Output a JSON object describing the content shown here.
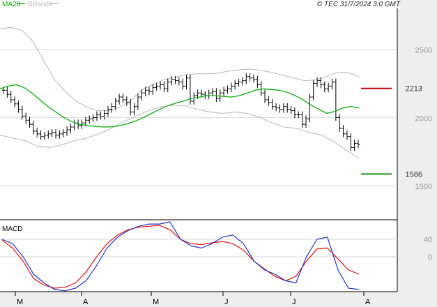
{
  "header": {
    "ma_label": "MA20",
    "bb_label": "BBands",
    "copyright": "© TEC 31/7/2024 3:0 GMT"
  },
  "colors": {
    "ma": "#11aa11",
    "bands": "#b8b8b8",
    "bars": "#000000",
    "resistance": "#cc0000",
    "support": "#119911",
    "macd": "#2233cc",
    "signal": "#dd1111",
    "grid": "#d8d8d8",
    "right_panel": "#eeeeee",
    "axis_text": "#999999"
  },
  "chart_data": [
    {
      "type": "line",
      "name": "price",
      "x_tick_labels": [
        "M",
        "A",
        "M",
        "J",
        "J",
        "A"
      ],
      "y_tick_labels": [
        "2500",
        "2000",
        "1500"
      ],
      "ylim": [
        1250,
        2800
      ],
      "grid": true,
      "levels": [
        {
          "label": "2213",
          "value": 2213,
          "color": "#cc0000"
        },
        {
          "label": "1586",
          "value": 1586,
          "color": "#119911"
        }
      ],
      "ohlc_close": [
        2200,
        2170,
        2130,
        2100,
        2060,
        2010,
        1980,
        1950,
        1900,
        1880,
        1860,
        1870,
        1880,
        1890,
        1870,
        1880,
        1890,
        1910,
        1930,
        1960,
        1940,
        1960,
        1980,
        1990,
        2000,
        2020,
        2010,
        2030,
        2060,
        2080,
        2120,
        2150,
        2130,
        2110,
        2040,
        2080,
        2150,
        2180,
        2200,
        2190,
        2220,
        2230,
        2240,
        2210,
        2260,
        2280,
        2270,
        2260,
        2230,
        2290,
        2120,
        2160,
        2180,
        2170,
        2160,
        2180,
        2190,
        2140,
        2180,
        2200,
        2210,
        2230,
        2250,
        2260,
        2270,
        2300,
        2290,
        2280,
        2240,
        2180,
        2130,
        2110,
        2080,
        2070,
        2060,
        2080,
        2060,
        2050,
        2020,
        2020,
        1950,
        1990,
        2150,
        2250,
        2270,
        2240,
        2210,
        2230,
        2260,
        2000,
        1920,
        1880,
        1860,
        1780,
        1810,
        1800
      ],
      "series": [
        {
          "name": "MA20",
          "values": [
            2210,
            2230,
            2240,
            2220,
            2180,
            2130,
            2080,
            2040,
            2000,
            1970,
            1950,
            1940,
            1935,
            1930,
            1932,
            1940,
            1955,
            1975,
            2000,
            2030,
            2060,
            2085,
            2105,
            2120,
            2140,
            2150,
            2160,
            2160,
            2155,
            2150,
            2160,
            2180,
            2200,
            2210,
            2205,
            2200,
            2185,
            2160,
            2130,
            2090,
            2060,
            2030,
            2045,
            2070,
            2080,
            2070
          ]
        },
        {
          "name": "BBands upper",
          "values": [
            2650,
            2660,
            2640,
            2560,
            2420,
            2280,
            2190,
            2120,
            2075,
            2050,
            2050,
            2075,
            2125,
            2200,
            2240,
            2275,
            2295,
            2310,
            2320,
            2320,
            2325,
            2340,
            2350,
            2355,
            2345,
            2330,
            2310,
            2290,
            2270,
            2275,
            2300,
            2330,
            2330,
            2300
          ]
        },
        {
          "name": "BBands lower",
          "values": [
            1870,
            1850,
            1830,
            1790,
            1780,
            1800,
            1830,
            1850,
            1880,
            1920,
            1970,
            2010,
            2050,
            2080,
            2090,
            2085,
            2060,
            2040,
            2030,
            2040,
            2030,
            2000,
            1960,
            1930,
            1920,
            1890,
            1870,
            1820,
            1760,
            1700
          ]
        }
      ]
    },
    {
      "type": "line",
      "title": "MACD",
      "y_tick_labels": [
        "40",
        "0"
      ],
      "ylim": [
        -80,
        80
      ],
      "grid": true,
      "series": [
        {
          "name": "MACD",
          "values": [
            40,
            30,
            0,
            -40,
            -60,
            -75,
            -78,
            -72,
            -55,
            -20,
            20,
            45,
            60,
            70,
            75,
            75,
            80,
            40,
            25,
            20,
            30,
            45,
            50,
            30,
            -10,
            -30,
            -40,
            -55,
            -60,
            0,
            40,
            45,
            -30,
            -72,
            -75
          ]
        },
        {
          "name": "Signal",
          "values": [
            38,
            20,
            -10,
            -50,
            -65,
            -72,
            -70,
            -60,
            -35,
            0,
            30,
            50,
            62,
            68,
            70,
            72,
            62,
            40,
            30,
            28,
            32,
            35,
            30,
            15,
            -10,
            -28,
            -45,
            -55,
            -45,
            -10,
            18,
            20,
            -5,
            -30,
            -40
          ]
        }
      ]
    }
  ]
}
